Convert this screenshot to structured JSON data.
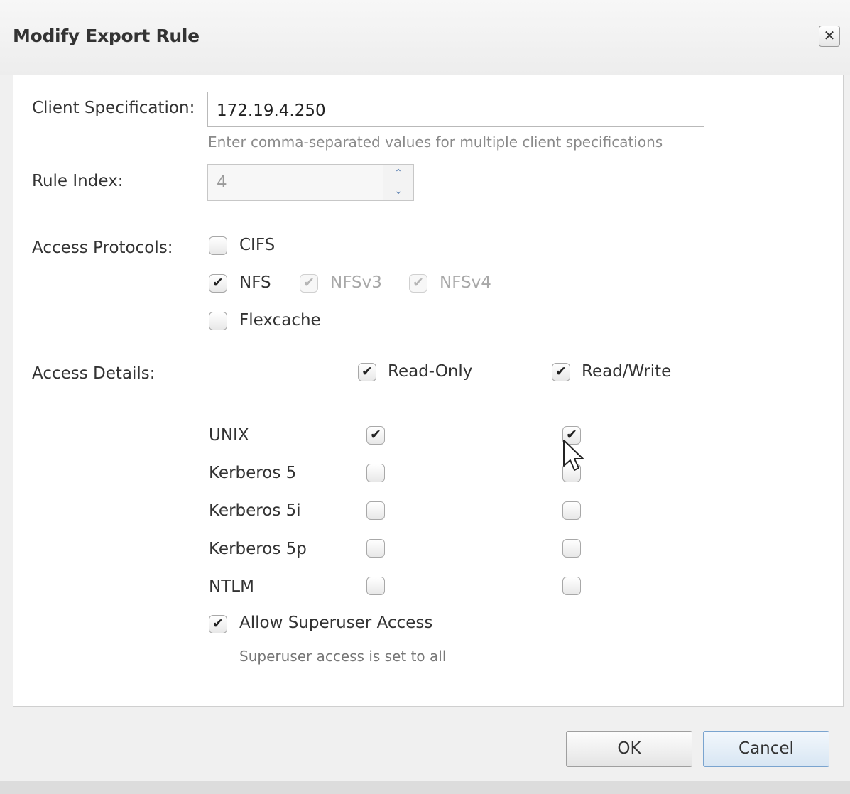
{
  "dialog": {
    "title": "Modify Export Rule",
    "close_glyph": "✕"
  },
  "form": {
    "client_spec": {
      "label": "Client Specification:",
      "value": "172.19.4.250",
      "hint": "Enter comma-separated values for multiple client specifications"
    },
    "rule_index": {
      "label": "Rule Index:",
      "value": "4"
    },
    "access_protocols": {
      "label": "Access Protocols:",
      "cifs": {
        "label": "CIFS",
        "checked": false
      },
      "nfs": {
        "label": "NFS",
        "checked": true
      },
      "nfsv3": {
        "label": "NFSv3",
        "checked": true,
        "disabled": true
      },
      "nfsv4": {
        "label": "NFSv4",
        "checked": true,
        "disabled": true
      },
      "flexcache": {
        "label": "Flexcache",
        "checked": false
      }
    },
    "access_details": {
      "label": "Access Details:",
      "read_only": {
        "label": "Read-Only",
        "checked": true
      },
      "read_write": {
        "label": "Read/Write",
        "checked": true
      },
      "rows": [
        {
          "label": "UNIX",
          "read_only": true,
          "read_write": true
        },
        {
          "label": "Kerberos 5",
          "read_only": false,
          "read_write": false
        },
        {
          "label": "Kerberos 5i",
          "read_only": false,
          "read_write": false
        },
        {
          "label": "Kerberos 5p",
          "read_only": false,
          "read_write": false
        },
        {
          "label": "NTLM",
          "read_only": false,
          "read_write": false
        }
      ],
      "superuser": {
        "label": "Allow Superuser Access",
        "checked": true,
        "note": "Superuser access is set to all"
      }
    }
  },
  "buttons": {
    "ok": "OK",
    "cancel": "Cancel"
  },
  "icons": {
    "check": "✔",
    "spin_up": "⌃",
    "spin_down": "⌄"
  }
}
